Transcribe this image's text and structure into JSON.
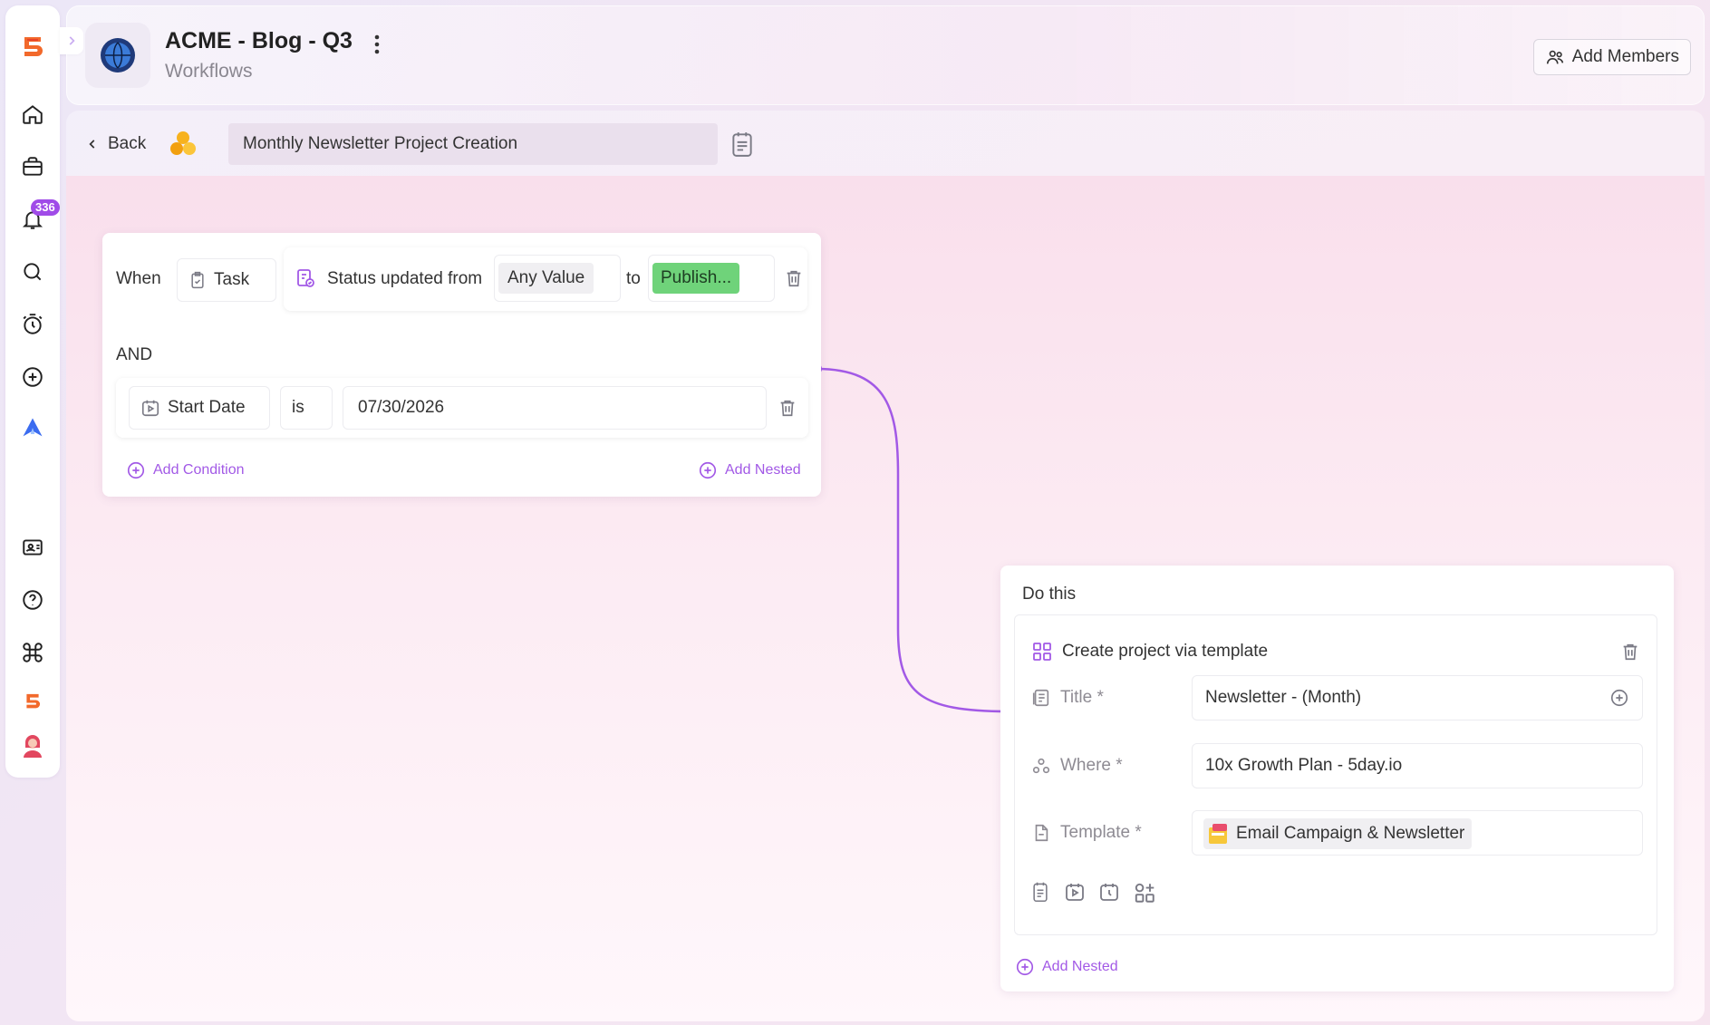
{
  "sidebar": {
    "notification_count": "336",
    "items": [
      {
        "name": "home-icon"
      },
      {
        "name": "briefcase-icon"
      },
      {
        "name": "bell-icon"
      },
      {
        "name": "search-icon"
      },
      {
        "name": "alarm-clock-icon"
      },
      {
        "name": "plus-circle-icon"
      },
      {
        "name": "rocket-icon"
      },
      {
        "name": "contact-card-icon"
      },
      {
        "name": "help-icon"
      },
      {
        "name": "command-icon"
      },
      {
        "name": "5day-logo-icon"
      },
      {
        "name": "user-avatar"
      }
    ]
  },
  "header": {
    "project_title": "ACME - Blog - Q3",
    "subtitle": "Workflows",
    "add_members_label": "Add Members"
  },
  "toolbar": {
    "back_label": "Back",
    "workflow_name": "Monthly Newsletter Project Creation"
  },
  "trigger": {
    "when_label": "When",
    "entity": "Task",
    "event_label": "Status updated from",
    "from_value": "Any Value",
    "to_label": "to",
    "to_value": "Publish...",
    "and_label": "AND",
    "condition": {
      "field": "Start Date",
      "operator": "is",
      "value": "07/30/2026"
    },
    "add_condition_label": "Add Condition",
    "add_nested_label": "Add Nested"
  },
  "action": {
    "heading": "Do this",
    "type_label": "Create project via template",
    "fields": {
      "title_label": "Title *",
      "title_value": "Newsletter - (Month)",
      "where_label": "Where *",
      "where_value": "10x Growth Plan - 5day.io",
      "template_label": "Template *",
      "template_value": "Email Campaign & Newsletter"
    },
    "add_nested_label": "Add Nested"
  },
  "colors": {
    "accent": "#a259e6",
    "status_green": "#6fd37a",
    "badge": "#a04be8"
  }
}
